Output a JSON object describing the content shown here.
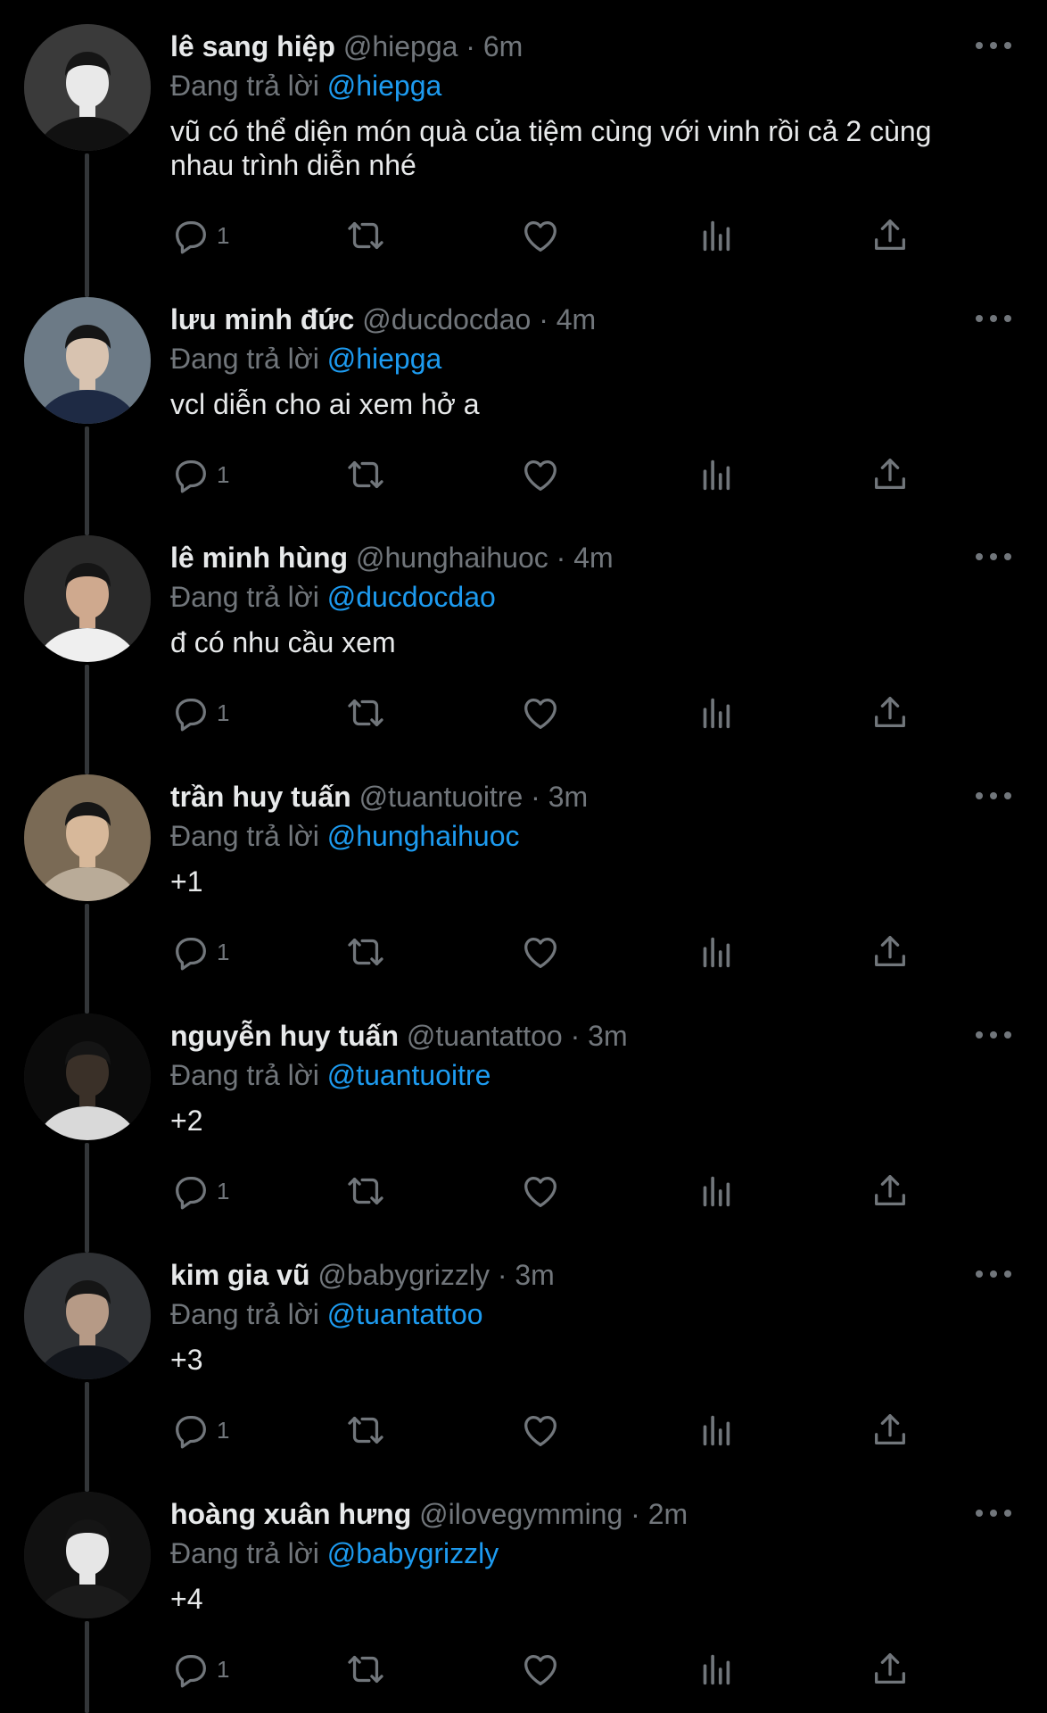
{
  "reply_prefix": "Đang trả lời",
  "colors": {
    "background": "#000000",
    "text_primary": "#e7e9ea",
    "text_secondary": "#71767b",
    "accent": "#1d9bf0",
    "thread_line": "#333639"
  },
  "icons": {
    "reply": "reply-bubble-icon",
    "retweet": "retweet-icon",
    "like": "heart-icon",
    "views": "views-bar-chart-icon",
    "share": "share-upload-icon",
    "more": "more-horizontal-icon"
  },
  "tweets": [
    {
      "name": "lê sang hiệp",
      "handle": "@hiepga",
      "dot": "·",
      "time": "6m",
      "replying_to": "@hiepga",
      "text": "vũ có thể diện món quà của tiệm cùng với vinh rồi cả 2 cùng nhau trình diễn nhé",
      "reply_count": "1"
    },
    {
      "name": "lưu minh đức",
      "handle": "@ducdocdao",
      "dot": "·",
      "time": "4m",
      "replying_to": "@hiepga",
      "text": "vcl diễn cho ai xem hở a",
      "reply_count": "1"
    },
    {
      "name": "lê minh hùng",
      "handle": "@hunghaihuoc",
      "dot": "·",
      "time": "4m",
      "replying_to": "@ducdocdao",
      "text": "đ có nhu cầu xem",
      "reply_count": "1"
    },
    {
      "name": "trần huy tuấn",
      "handle": "@tuantuoitre",
      "dot": "·",
      "time": "3m",
      "replying_to": "@hunghaihuoc",
      "text": "+1",
      "reply_count": "1"
    },
    {
      "name": "nguyễn huy tuấn",
      "handle": "@tuantattoo",
      "dot": "·",
      "time": "3m",
      "replying_to": "@tuantuoitre",
      "text": "+2",
      "reply_count": "1"
    },
    {
      "name": "kim gia vũ",
      "handle": "@babygrizzly",
      "dot": "·",
      "time": "3m",
      "replying_to": "@tuantattoo",
      "text": "+3",
      "reply_count": "1"
    },
    {
      "name": "hoàng xuân hưng",
      "handle": "@ilovegymming",
      "dot": "·",
      "time": "2m",
      "replying_to": "@babygrizzly",
      "text": "+4",
      "reply_count": "1"
    }
  ]
}
